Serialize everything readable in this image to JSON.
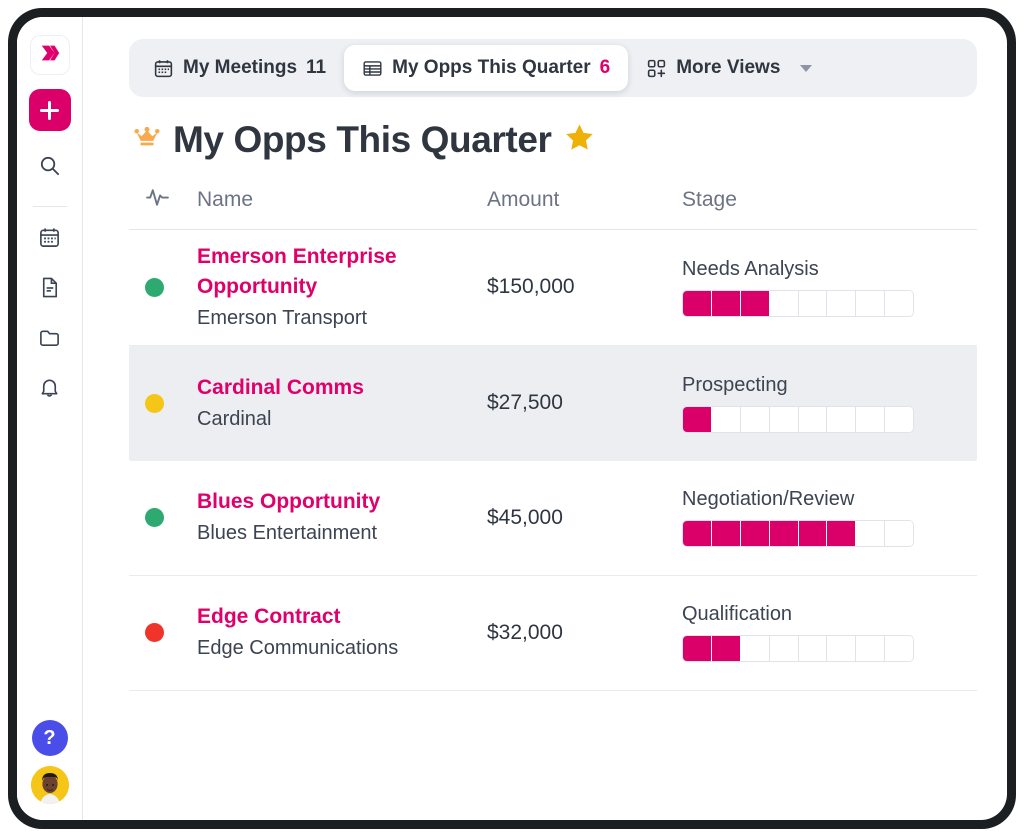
{
  "sidebar": {
    "logo_icon": "double-chevron-logo",
    "add_button": {
      "icon": "plus-icon",
      "label": "+"
    },
    "items": [
      {
        "icon": "search-icon",
        "name": "search"
      },
      {
        "icon": "calendar-icon",
        "name": "calendar"
      },
      {
        "icon": "document-icon",
        "name": "documents"
      },
      {
        "icon": "folder-icon",
        "name": "files"
      },
      {
        "icon": "bell-icon",
        "name": "notifications"
      }
    ],
    "help": {
      "icon": "question-mark-icon",
      "label": "?"
    },
    "avatar": {
      "icon": "user-avatar",
      "background": "#F5C518"
    }
  },
  "tabs": [
    {
      "icon": "calendar-icon",
      "label": "My Meetings",
      "count": "11",
      "active": false
    },
    {
      "icon": "table-grid-icon",
      "label": "My Opps This Quarter",
      "count": "6",
      "active": true
    },
    {
      "icon": "add-view-grid-icon",
      "label": "More Views",
      "count": "",
      "active": false,
      "caret": true
    }
  ],
  "header": {
    "crown_icon": "crown-icon",
    "title": "My Opps This Quarter",
    "star_icon": "star-icon"
  },
  "table": {
    "columns": {
      "status_icon": "activity-pulse-icon",
      "name": "Name",
      "amount": "Amount",
      "stage": "Stage"
    },
    "pipeline_total_segments": 8,
    "rows": [
      {
        "status_color": "#2ea96f",
        "status_name": "green",
        "name": "Emerson Enterprise Opportunity",
        "account": "Emerson Transport",
        "amount": "$150,000",
        "stage": "Needs Analysis",
        "stage_filled": 3,
        "highlighted": false
      },
      {
        "status_color": "#F5C518",
        "status_name": "yellow",
        "name": "Cardinal Comms",
        "account": "Cardinal",
        "amount": "$27,500",
        "stage": "Prospecting",
        "stage_filled": 1,
        "highlighted": true
      },
      {
        "status_color": "#2ea96f",
        "status_name": "green",
        "name": "Blues Opportunity",
        "account": "Blues Entertainment",
        "amount": "$45,000",
        "stage": "Negotiation/Review",
        "stage_filled": 6,
        "highlighted": false
      },
      {
        "status_color": "#F0342B",
        "status_name": "red",
        "name": "Edge Contract",
        "account": "Edge Communications",
        "amount": "$32,000",
        "stage": "Qualification",
        "stage_filled": 2,
        "highlighted": false
      }
    ]
  },
  "colors": {
    "accent_pink": "#DB0069",
    "link_pink": "#E0006B",
    "text_dark": "#2f3640",
    "text_muted": "#6b7385",
    "tabbar_bg": "#eef0f4",
    "row_highlight": "#eceef2",
    "help_blue": "#4a4de8",
    "crown_orange": "#F7A94B",
    "star_gold": "#EFB008"
  }
}
